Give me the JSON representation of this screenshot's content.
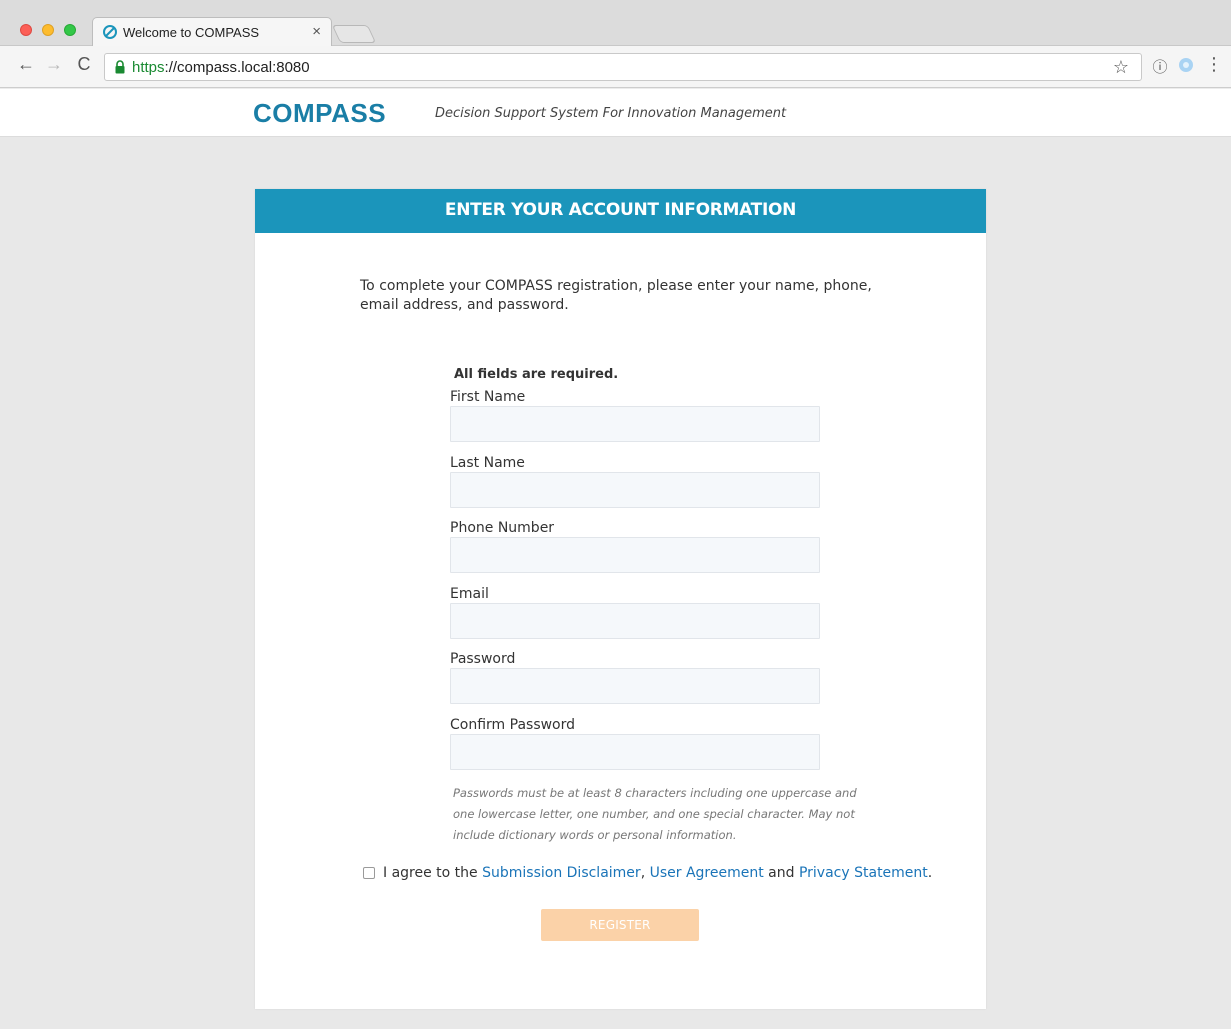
{
  "browser": {
    "tab_title": "Welcome to COMPASS",
    "tab_close": "×",
    "url_scheme": "https",
    "url_rest": "://compass.local:8080",
    "back": "←",
    "forward": "→",
    "reload": "C",
    "star": "☆",
    "ext_info": "ⓘ",
    "menu": "⋮"
  },
  "header": {
    "logo": "COMPASS",
    "tagline": "Decision Support System For Innovation Management"
  },
  "form": {
    "title": "ENTER YOUR ACCOUNT INFORMATION",
    "intro": "To complete your COMPASS registration, please enter your name, phone, email address, and password.",
    "required_note": "All fields are required.",
    "fields": [
      {
        "label": "First Name",
        "value": ""
      },
      {
        "label": "Last Name",
        "value": ""
      },
      {
        "label": "Phone Number",
        "value": ""
      },
      {
        "label": "Email",
        "value": ""
      },
      {
        "label": "Password",
        "value": ""
      },
      {
        "label": "Confirm Password",
        "value": ""
      }
    ],
    "password_hint": "Passwords must be at least 8 characters including one uppercase and one lowercase letter, one number, and one special character. May not include dictionary words or personal information.",
    "agree": {
      "prefix": "I agree to the ",
      "link1": "Submission Disclaimer",
      "sep1": ", ",
      "link2": "User Agreement",
      "sep2": " and ",
      "link3": "Privacy Statement",
      "suffix": "."
    },
    "register_label": "REGISTER"
  },
  "colors": {
    "brand_blue": "#1b95bb",
    "logo_blue": "#1a7ea6",
    "link_blue": "#1a74b8",
    "register_disabled": "#fbd2a8"
  }
}
